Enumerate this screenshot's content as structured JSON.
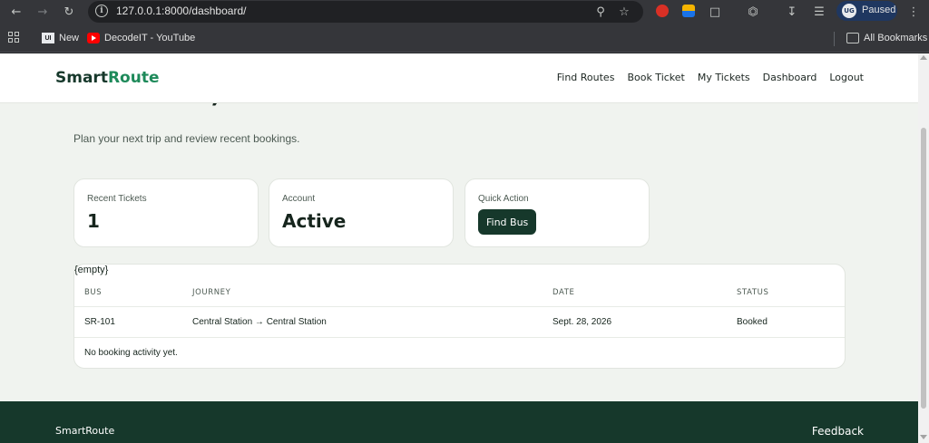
{
  "browser": {
    "url": "127.0.0.1:8000/dashboard/",
    "profile_label": "Paused",
    "profile_initials": "UG",
    "bookmarks": [
      {
        "label": "New"
      },
      {
        "label": "DecodeIT - YouTube"
      }
    ],
    "all_bookmarks_label": "All Bookmarks"
  },
  "header": {
    "brand_part1": "Smart",
    "brand_part2": "Route",
    "nav": [
      "Find Routes",
      "Book Ticket",
      "My Tickets",
      "Dashboard",
      "Logout"
    ]
  },
  "main": {
    "welcome": "Welcome, user",
    "subtitle": "Plan your next trip and review recent bookings."
  },
  "cards": {
    "recent_tickets_label": "Recent Tickets",
    "recent_tickets_value": "1",
    "account_label": "Account",
    "account_value": "Active",
    "quick_action_label": "Quick Action",
    "quick_action_button": "Find Bus"
  },
  "table": {
    "empty_tag": "{empty}",
    "columns": [
      "BUS",
      "JOURNEY",
      "DATE",
      "STATUS"
    ],
    "rows": [
      [
        "SR-101",
        "Central Station → Central Station",
        "Sept. 28, 2026",
        "Booked"
      ]
    ],
    "empty_message": "No booking activity yet."
  },
  "footer": {
    "brand": "SmartRoute",
    "link": "Feedback"
  },
  "colors": {
    "brand_dark": "#16382b",
    "brand_green": "#1e8a5a",
    "page_bg": "#f0f3ef"
  }
}
